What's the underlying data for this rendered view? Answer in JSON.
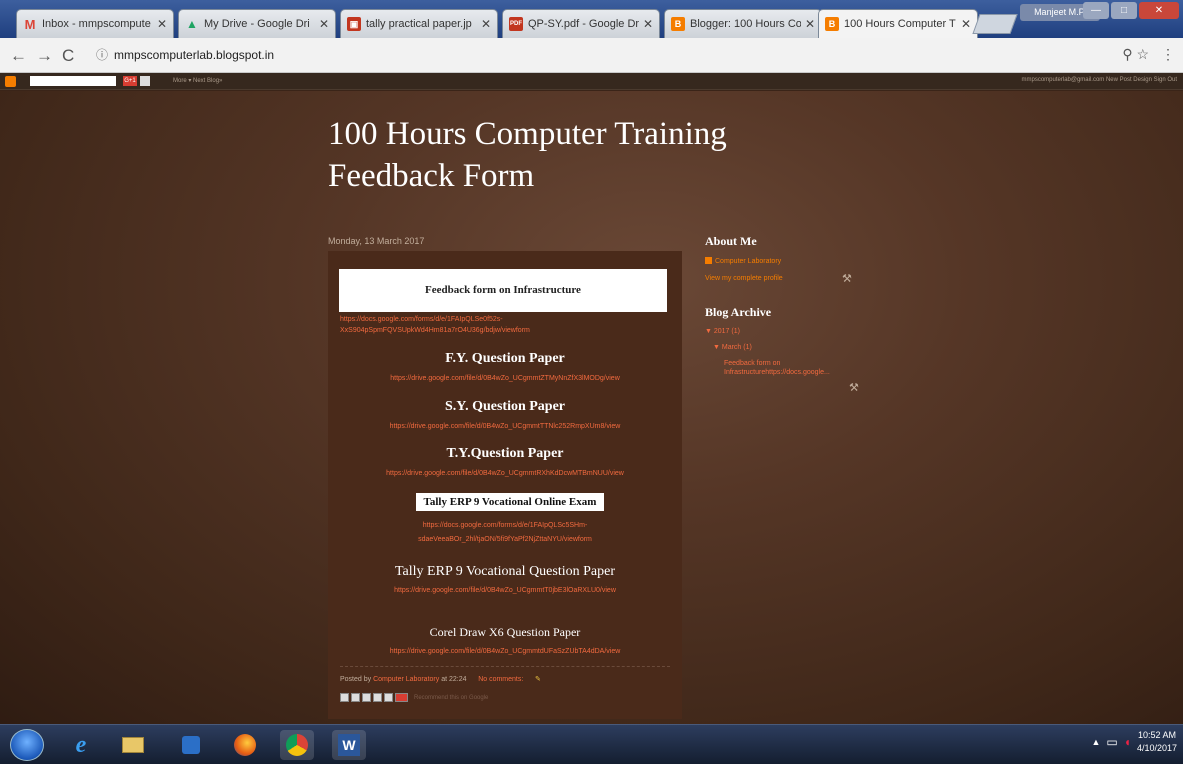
{
  "tabs": [
    {
      "title": "Inbox - mmpscompute",
      "icon": "gmail-icon",
      "color": "#db4437",
      "glyph": "M"
    },
    {
      "title": "My Drive - Google Dri",
      "icon": "drive-icon",
      "color": "#1fa463",
      "glyph": "▲"
    },
    {
      "title": "tally practical paper.jp",
      "icon": "image-icon",
      "color": "#c2361f",
      "glyph": "▣"
    },
    {
      "title": "QP-SY.pdf - Google Dr",
      "icon": "pdf-icon",
      "color": "#c2361f",
      "glyph": "PDF"
    },
    {
      "title": "Blogger: 100 Hours Co",
      "icon": "blogger-icon",
      "color": "#f57d00",
      "glyph": "B"
    },
    {
      "title": "100 Hours Computer T",
      "icon": "blogger-icon",
      "color": "#f57d00",
      "glyph": "B"
    }
  ],
  "user_chip": "Manjeet M.P.",
  "address": {
    "url": "mmpscomputerlab.blogspot.in"
  },
  "navbar": {
    "gplus": "G+1",
    "more": "More ▾  Next Blog»",
    "right": "mmpscomputerlab@gmail.com   New Post   Design   Sign Out"
  },
  "blog": {
    "title": "100 Hours Computer Training Feedback Form"
  },
  "post": {
    "date": "Monday, 13 March 2017",
    "header": "Feedback form on Infrastructure",
    "link_infra": "https://docs.google.com/forms/d/e/1FAIpQLSe0f52s-XxS904pSpmFQVSUpkWd4Hm81a7rO4U36g/bdjw/viewform",
    "fy_title": "F.Y. Question Paper",
    "fy_link": "https://drive.google.com/file/d/0B4wZo_UCgmmtZTMyNnZfX3lMODg/view",
    "sy_title": "S.Y. Question Paper",
    "sy_link": "https://drive.google.com/file/d/0B4wZo_UCgmmtTTNlc252RmpXUm8/view",
    "ty_title": "T.Y.Question Paper",
    "ty_link": "https://drive.google.com/file/d/0B4wZo_UCgmmtRXhKdDcwMTBmNUU/view",
    "tally_online_title": "Tally ERP 9 Vocational Online Exam",
    "tally_online_link": "https://docs.google.com/forms/d/e/1FAIpQLSc5SHm-sdaeVeeaBOr_2hl/tjaON/5fi9fYaPf2NjZttaNYU/viewform",
    "tally_q_title": "Tally ERP 9 Vocational Question Paper",
    "tally_q_link": "https://drive.google.com/file/d/0B4wZo_UCgmmtT0jbE3lOaRXLU0/view",
    "corel_title": "Corel Draw X6 Question Paper",
    "corel_link": "https://drive.google.com/file/d/0B4wZo_UCgmmtdUFaSzZUbTA4dDA/view",
    "posted_by": "Posted by",
    "author": "Computer Laboratory",
    "at": "at 22:24",
    "comments": "No comments:",
    "share_note": "Recommend this on Google"
  },
  "sidebar": {
    "about_heading": "About Me",
    "profile_name": "Computer Laboratory",
    "profile_link": "View my complete profile",
    "archive_heading": "Blog Archive",
    "year": "▼ 2017 (1)",
    "month": "▼ March (1)",
    "post_link": "Feedback form on Infrastructurehttps://docs.google..."
  },
  "taskbar": {
    "time": "10:52 AM",
    "date": "4/10/2017"
  }
}
